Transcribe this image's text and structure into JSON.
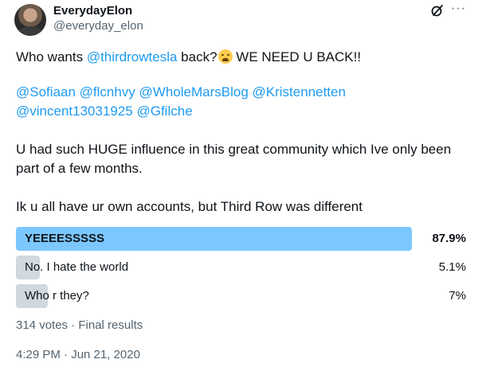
{
  "author": {
    "name": "EverydayElon",
    "handle": "@everyday_elon"
  },
  "header_icons": [
    "grok-icon",
    "more-icon"
  ],
  "header_more_glyph": "···",
  "tweet": {
    "line1": {
      "before": "Who wants ",
      "mention": "@thirdrowtesla",
      "after": " back?",
      "emoji": "weary-face-emoji",
      "tail": " WE NEED U BACK!!"
    },
    "mentions_line1": "@Sofiaan @flcnhvy @WholeMarsBlog @Kristennetten",
    "mentions_line2": "@vincent13031925 @Gfilche",
    "paragraph2_line1": "U had such HUGE influence in this great community which Ive only been",
    "paragraph2_line2": "part of a few months.",
    "paragraph3": "Ik u all have ur own accounts, but Third Row was different"
  },
  "poll": {
    "options": [
      {
        "label": "YEEEESSSSS",
        "percent": "87.9%",
        "share": 0.879,
        "winner": true
      },
      {
        "label": "No. I hate the world",
        "percent": "5.1%",
        "share": 0.051,
        "winner": false
      },
      {
        "label": "Who r they?",
        "percent": "7%",
        "share": 0.07,
        "winner": false
      }
    ],
    "summary": "314 votes · Final results"
  },
  "timestamp": "4:29 PM · Jun 21, 2020",
  "colors": {
    "mention": "#1d9bf0",
    "winner_bar": "#7cc7ff",
    "other_bar": "#cfd9de",
    "secondary_text": "#536471"
  }
}
